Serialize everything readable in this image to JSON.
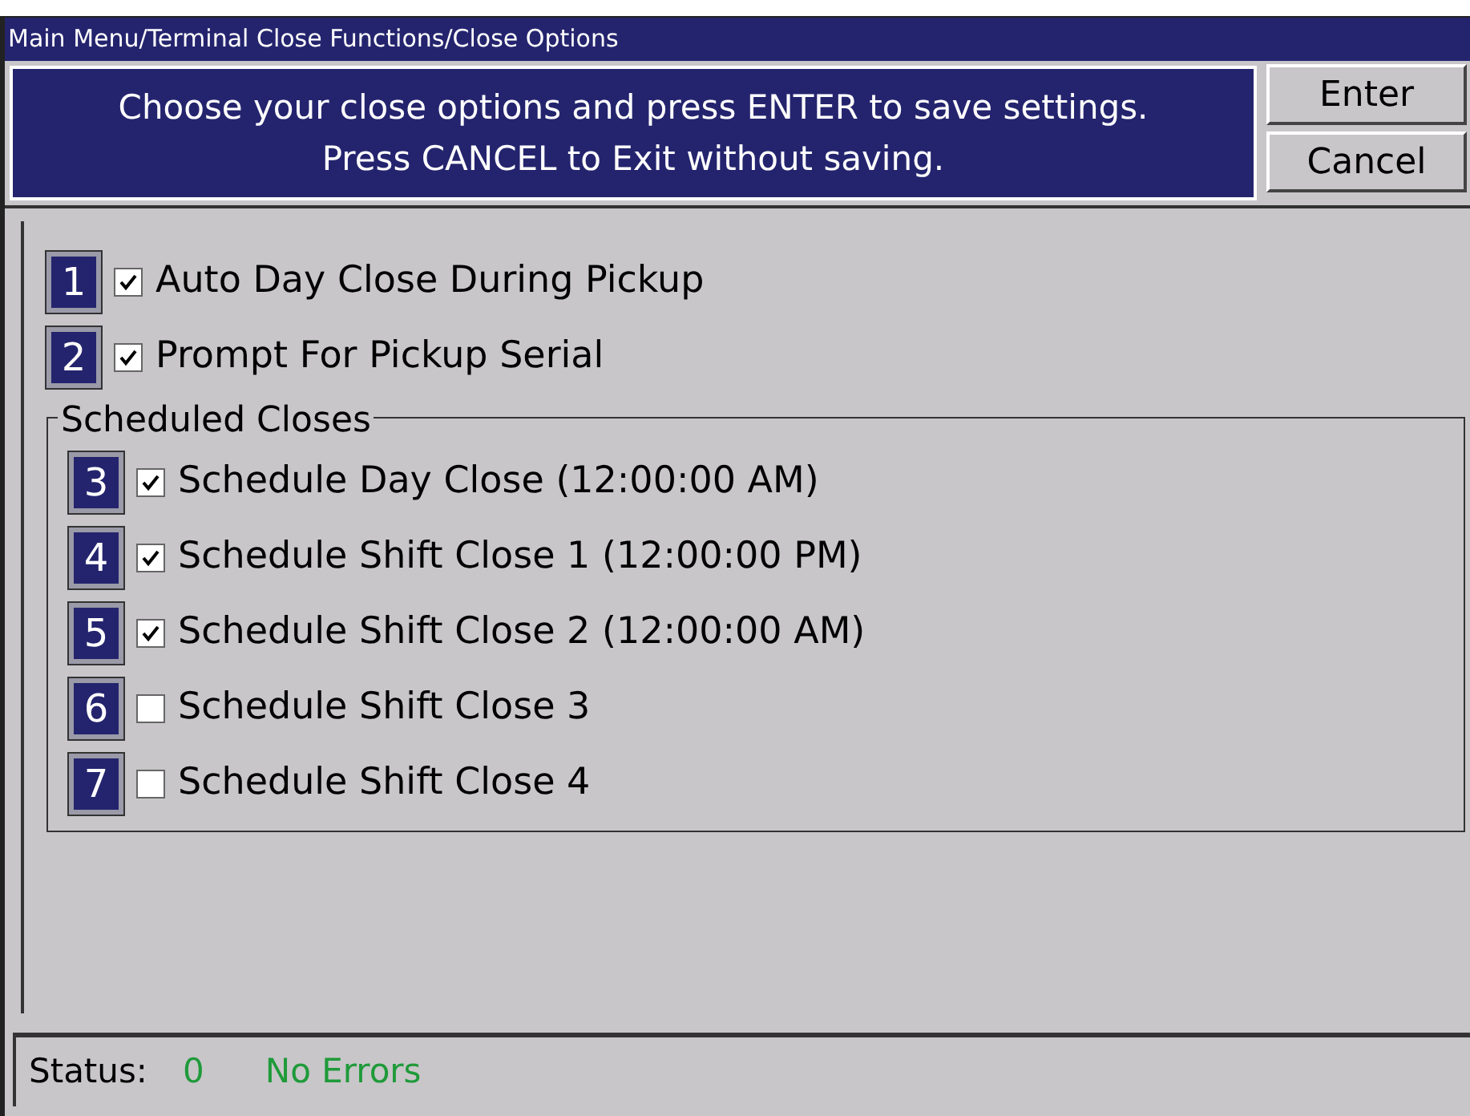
{
  "window": {
    "title": "Main Menu/Terminal Close Functions/Close Options"
  },
  "instructions": [
    "Choose your close options and press ENTER to save settings.",
    "Press CANCEL to Exit without saving."
  ],
  "buttons": [
    "Enter",
    "Cancel"
  ],
  "options": [
    {
      "key": "1",
      "label": "Auto Day Close During Pickup",
      "checked": true
    },
    {
      "key": "2",
      "label": "Prompt For Pickup Serial",
      "checked": true
    }
  ],
  "scheduled_closes": {
    "title": "Scheduled Closes",
    "options": [
      {
        "key": "3",
        "label": "Schedule Day Close (12:00:00 AM)",
        "checked": true
      },
      {
        "key": "4",
        "label": "Schedule Shift Close 1 (12:00:00 PM)",
        "checked": true
      },
      {
        "key": "5",
        "label": "Schedule Shift Close 2 (12:00:00 AM)",
        "checked": true
      },
      {
        "key": "6",
        "label": "Schedule Shift Close 3",
        "checked": false
      },
      {
        "key": "7",
        "label": "Schedule Shift Close 4",
        "checked": false
      }
    ]
  },
  "status_bar": {
    "label": "Status:",
    "code": "0",
    "message": "No Errors"
  }
}
